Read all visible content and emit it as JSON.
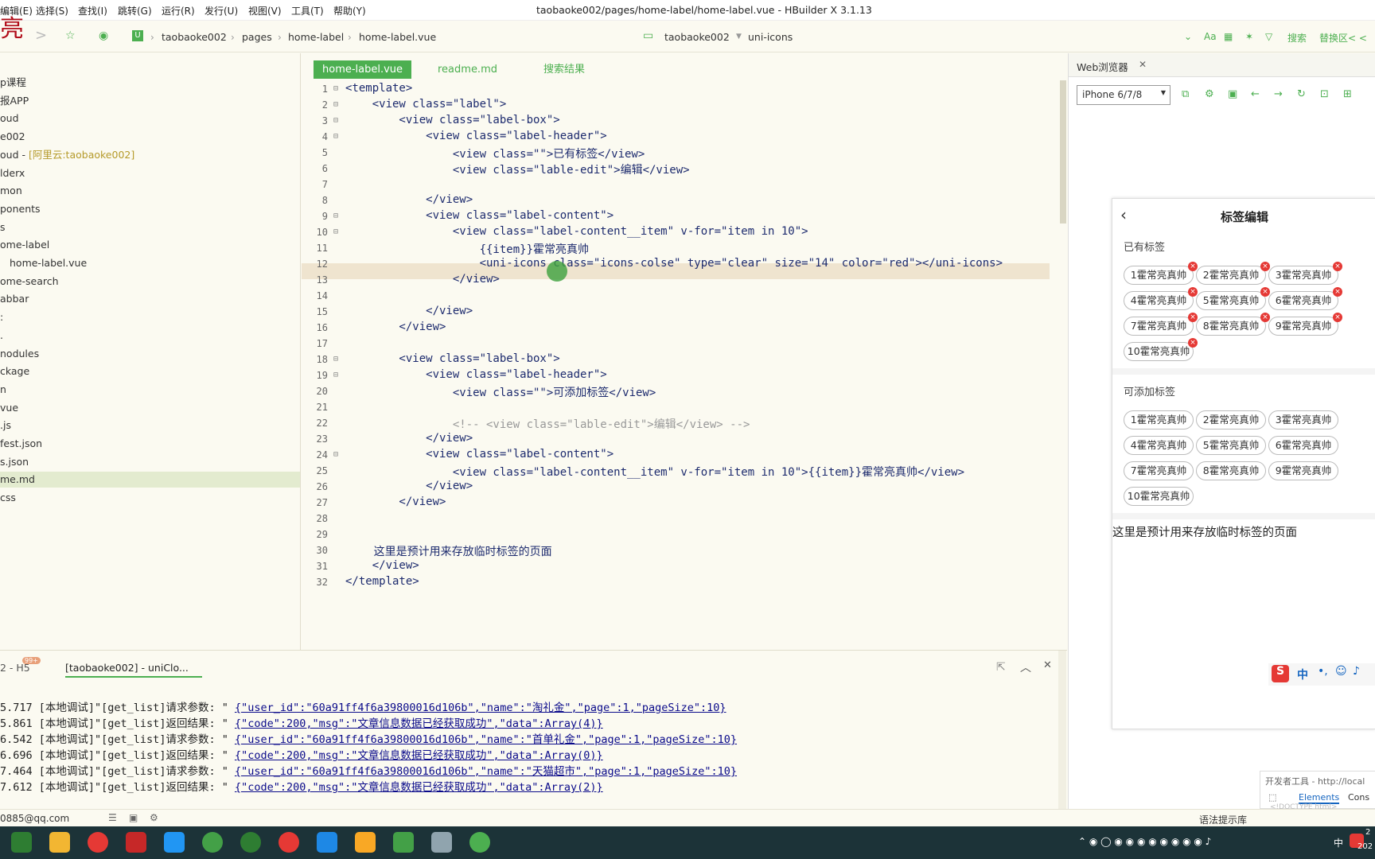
{
  "menu": [
    "编辑(E)",
    "选择(S)",
    "查找(I)",
    "跳转(G)",
    "运行(R)",
    "发行(U)",
    "视图(V)",
    "工具(T)",
    "帮助(Y)"
  ],
  "window_title": "taobaoke002/pages/home-label/home-label.vue - HBuilder X 3.1.13",
  "logo_char": "亮",
  "breadcrumb": [
    "taobaoke002",
    "pages",
    "home-label",
    "home-label.vue"
  ],
  "project_select": {
    "name": "taobaoke002",
    "file": "uni-icons"
  },
  "toolbar_right": {
    "search": "搜索",
    "replace": "替换区< <"
  },
  "sidebar_items": [
    {
      "label": "p课程"
    },
    {
      "label": "报APP"
    },
    {
      "label": "oud"
    },
    {
      "label": "e002"
    },
    {
      "label": "oud - ",
      "extra": "[阿里云:taobaoke002]"
    },
    {
      "label": "lderx"
    },
    {
      "label": "mon"
    },
    {
      "label": "ponents"
    },
    {
      "label": "s"
    },
    {
      "label": "ome-label"
    },
    {
      "label": "home-label.vue"
    },
    {
      "label": "ome-search"
    },
    {
      "label": "abbar"
    },
    {
      "label": ":"
    },
    {
      "label": "."
    },
    {
      "label": "nodules"
    },
    {
      "label": "ckage"
    },
    {
      "label": "n"
    },
    {
      "label": "vue"
    },
    {
      "label": ".js"
    },
    {
      "label": "fest.json"
    },
    {
      "label": "s.json"
    },
    {
      "label": "me.md"
    },
    {
      "label": "css"
    }
  ],
  "editor_tabs": [
    "home-label.vue",
    "readme.md",
    "搜索结果"
  ],
  "code_lines": [
    {
      "n": "1",
      "t": "<template>"
    },
    {
      "n": "2",
      "t": "    <view class=\"label\">"
    },
    {
      "n": "3",
      "t": "        <view class=\"label-box\">"
    },
    {
      "n": "4",
      "t": "            <view class=\"label-header\">"
    },
    {
      "n": "5",
      "t": "                <view class=\"\">已有标签</view>"
    },
    {
      "n": "6",
      "t": "                <view class=\"lable-edit\">编辑</view>"
    },
    {
      "n": "7",
      "t": ""
    },
    {
      "n": "8",
      "t": "            </view>"
    },
    {
      "n": "9",
      "t": "            <view class=\"label-content\">"
    },
    {
      "n": "10",
      "t": "                <view class=\"label-content__item\" v-for=\"item in 10\">"
    },
    {
      "n": "11",
      "t": "                    {{item}}霍常亮真帅"
    },
    {
      "n": "12",
      "t": "                    <uni-icons class=\"icons-colse\" type=\"clear\" size=\"14\" color=\"red\"></uni-icons>"
    },
    {
      "n": "13",
      "t": "                </view>"
    },
    {
      "n": "14",
      "t": ""
    },
    {
      "n": "15",
      "t": "            </view>"
    },
    {
      "n": "16",
      "t": "        </view>"
    },
    {
      "n": "17",
      "t": ""
    },
    {
      "n": "18",
      "t": "        <view class=\"label-box\">"
    },
    {
      "n": "19",
      "t": "            <view class=\"label-header\">"
    },
    {
      "n": "20",
      "t": "                <view class=\"\">可添加标签</view>"
    },
    {
      "n": "21",
      "t": ""
    },
    {
      "n": "22",
      "t": "                <!-- <view class=\"lable-edit\">编辑</view> -->"
    },
    {
      "n": "23",
      "t": "            </view>"
    },
    {
      "n": "24",
      "t": "            <view class=\"label-content\">"
    },
    {
      "n": "25",
      "t": "                <view class=\"label-content__item\" v-for=\"item in 10\">{{item}}霍常亮真帅</view>"
    },
    {
      "n": "26",
      "t": "            </view>"
    },
    {
      "n": "27",
      "t": "        </view>"
    },
    {
      "n": "28",
      "t": ""
    },
    {
      "n": "29",
      "t": ""
    },
    {
      "n": "30",
      "t": "        这里是预计用来存放临时标签的页面"
    },
    {
      "n": "31",
      "t": "    </view>"
    },
    {
      "n": "32",
      "t": "</template>"
    }
  ],
  "console": {
    "tab_left": "2 - H5",
    "badge": "99+",
    "tab_active": "[taobaoke002] - uniClo...",
    "logs": [
      {
        "time": "5.717",
        "text": "[本地调试]\"[get_list]请求参数: \" ",
        "json": "{\"user_id\":\"60a91ff4f6a39800016d106b\",\"name\":\"淘礼金\",\"page\":1,\"pageSize\":10}"
      },
      {
        "time": "5.861",
        "text": "[本地调试]\"[get_list]返回结果: \" ",
        "json": "{\"code\":200,\"msg\":\"文章信息数据已经获取成功\",\"data\":Array(4)}"
      },
      {
        "time": "6.542",
        "text": "[本地调试]\"[get_list]请求参数: \" ",
        "json": "{\"user_id\":\"60a91ff4f6a39800016d106b\",\"name\":\"首单礼金\",\"page\":1,\"pageSize\":10}"
      },
      {
        "time": "6.696",
        "text": "[本地调试]\"[get_list]返回结果: \" ",
        "json": "{\"code\":200,\"msg\":\"文章信息数据已经获取成功\",\"data\":Array(0)}"
      },
      {
        "time": "7.464",
        "text": "[本地调试]\"[get_list]请求参数: \" ",
        "json": "{\"user_id\":\"60a91ff4f6a39800016d106b\",\"name\":\"天猫超市\",\"page\":1,\"pageSize\":10}"
      },
      {
        "time": "7.612",
        "text": "[本地调试]\"[get_list]返回结果: \" ",
        "json": "{\"code\":200,\"msg\":\"文章信息数据已经获取成功\",\"data\":Array(2)}"
      }
    ]
  },
  "status": {
    "email": "0885@qq.com",
    "hint": "语法提示库"
  },
  "browser": {
    "tab": "Web浏览器",
    "device": "iPhone 6/7/8",
    "page_title": "标签编辑",
    "section1": "已有标签",
    "section2": "可添加标签",
    "tags": [
      "1霍常亮真帅",
      "2霍常亮真帅",
      "3霍常亮真帅",
      "4霍常亮真帅",
      "5霍常亮真帅",
      "6霍常亮真帅",
      "7霍常亮真帅",
      "8霍常亮真帅",
      "9霍常亮真帅",
      "10霍常亮真帅"
    ],
    "footer_text": "这里是预计用来存放临时标签的页面",
    "devtools_title": "开发者工具 - http://local",
    "devtools_tabs": [
      "Elements",
      "Cons"
    ],
    "devtools_line": "<!DOCTYPE html>",
    "ime": "中"
  },
  "clock": {
    "line1": "2",
    "line2": "202"
  },
  "colors": {
    "accent": "#4caf50",
    "logo": "#b10d1a",
    "close": "#e53935"
  }
}
